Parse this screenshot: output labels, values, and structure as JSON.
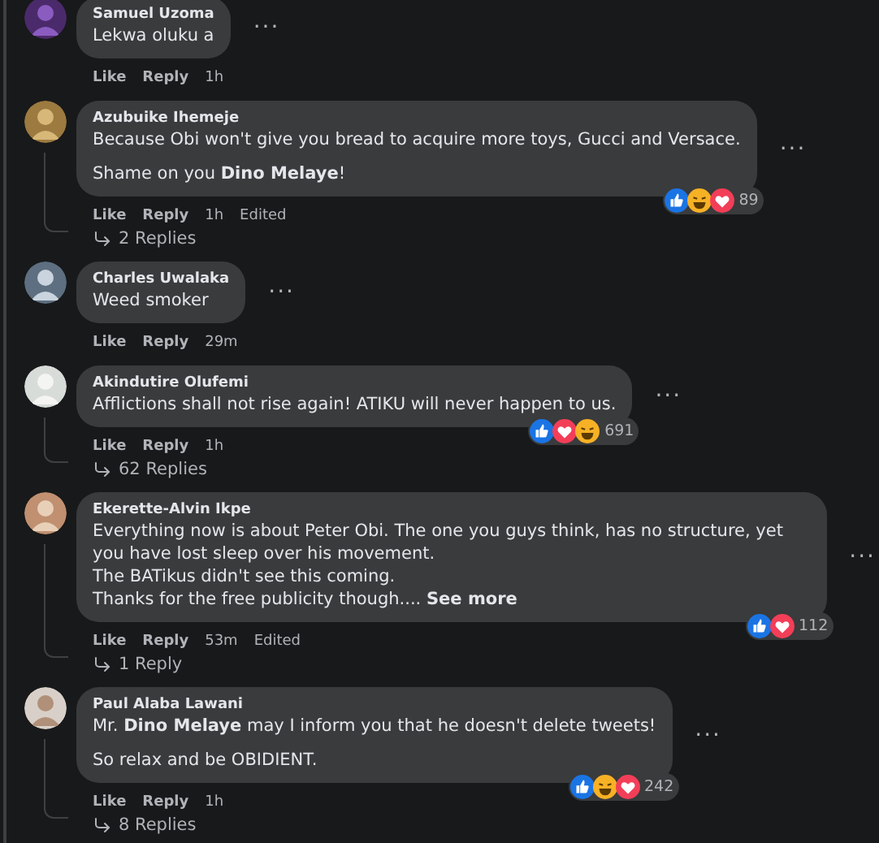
{
  "comments": [
    {
      "author": "Samuel Uzoma",
      "paragraphs": [
        {
          "lines": [
            "Lekwa oluku a"
          ]
        }
      ],
      "menu": "···",
      "actions": [
        "Like",
        "Reply",
        "1h"
      ]
    },
    {
      "author": "Azubuike Ihemeje",
      "paragraphs": [
        {
          "lines": [
            "Because Obi won't give you bread to acquire more toys, Gucci and Versace."
          ]
        },
        {
          "lines": [
            "Shame on you **Dino Melaye**!"
          ]
        }
      ],
      "menu": "···",
      "actions": [
        "Like",
        "Reply",
        "1h",
        "Edited"
      ],
      "reactions": [
        {
          "kind": "like"
        },
        {
          "kind": "haha"
        },
        {
          "kind": "love"
        }
      ],
      "count": "89",
      "replies": "2 Replies"
    },
    {
      "author": "Charles Uwalaka",
      "paragraphs": [
        {
          "lines": [
            "Weed smoker"
          ]
        }
      ],
      "menu": "···",
      "actions": [
        "Like",
        "Reply",
        "29m"
      ]
    },
    {
      "author": "Akindutire Olufemi",
      "paragraphs": [
        {
          "lines": [
            "Afflictions shall not rise again! ATIKU will never happen to us."
          ]
        }
      ],
      "menu": "···",
      "actions": [
        "Like",
        "Reply",
        "1h"
      ],
      "reactions": [
        {
          "kind": "like"
        },
        {
          "kind": "love"
        },
        {
          "kind": "haha"
        }
      ],
      "count": "691",
      "replies": "62 Replies"
    },
    {
      "author": "Ekerette-Alvin Ikpe",
      "paragraphs": [
        {
          "lines": [
            "Everything now is about Peter Obi. The one you guys think, has no structure, yet you have lost sleep over his movement.",
            "The BATikus didn't see this coming.",
            "Thanks for the free publicity though...."
          ]
        }
      ],
      "see_more": "See more",
      "menu": "···",
      "actions": [
        "Like",
        "Reply",
        "53m",
        "Edited"
      ],
      "reactions": [
        {
          "kind": "like"
        },
        {
          "kind": "love"
        }
      ],
      "count": "112",
      "replies": "1 Reply"
    },
    {
      "author": "Paul Alaba Lawani",
      "paragraphs": [
        {
          "lines": [
            "Mr. **Dino Melaye** may I inform you that he doesn't delete tweets!"
          ]
        },
        {
          "lines": [
            "So relax and be OBIDIENT."
          ]
        }
      ],
      "menu": "···",
      "actions": [
        "Like",
        "Reply",
        "1h"
      ],
      "reactions": [
        {
          "kind": "like"
        },
        {
          "kind": "haha"
        },
        {
          "kind": "love"
        }
      ],
      "count": "242",
      "replies": "8 Replies"
    }
  ]
}
